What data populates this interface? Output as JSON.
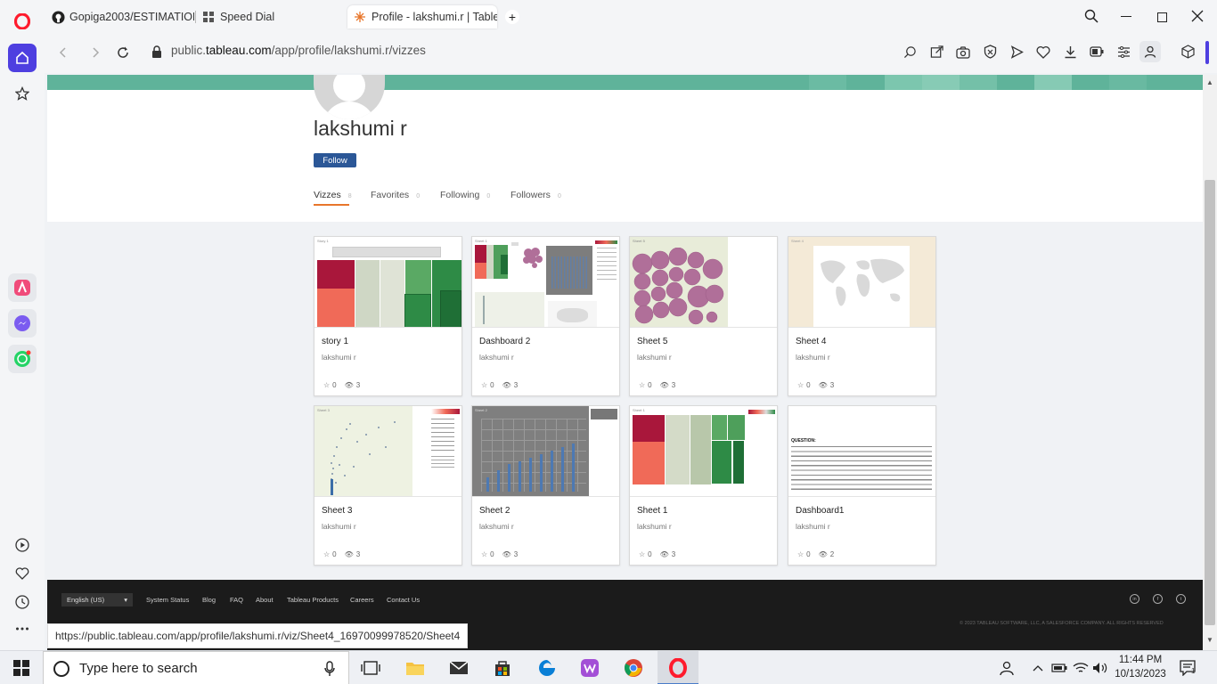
{
  "browser": {
    "tabs": [
      {
        "title": "Gopiga2003/ESTIMATION",
        "icon": "github-icon"
      },
      {
        "title": "Speed Dial",
        "icon": "speed-dial-icon"
      },
      {
        "title": "Profile - lakshumi.r | Table",
        "icon": "tableau-icon",
        "active": true
      }
    ],
    "url_prefix": "public.",
    "url_host": "tableau.com",
    "url_path": "/app/profile/lakshumi.r/vizzes",
    "status_url": "https://public.tableau.com/app/profile/lakshumi.r/viz/Sheet4_16970099978520/Sheet4"
  },
  "profile": {
    "name": "lakshumi r",
    "follow_label": "Follow",
    "tabs": [
      {
        "label": "Vizzes",
        "count": "8"
      },
      {
        "label": "Favorites",
        "count": "0"
      },
      {
        "label": "Following",
        "count": "0"
      },
      {
        "label": "Followers",
        "count": "0"
      }
    ]
  },
  "vizzes": [
    {
      "title": "story 1",
      "author": "lakshumi r",
      "favorites": "0",
      "views": "3",
      "thumb": "story",
      "thumb_label": "Story 1"
    },
    {
      "title": "Dashboard 2",
      "author": "lakshumi r",
      "favorites": "0",
      "views": "3",
      "thumb": "dashboard",
      "thumb_label": "Sheet 1"
    },
    {
      "title": "Sheet 5",
      "author": "lakshumi r",
      "favorites": "0",
      "views": "3",
      "thumb": "bubbles",
      "thumb_label": "Sheet 5"
    },
    {
      "title": "Sheet 4",
      "author": "lakshumi r",
      "favorites": "0",
      "views": "3",
      "thumb": "map",
      "thumb_label": "Sheet 4"
    },
    {
      "title": "Sheet 3",
      "author": "lakshumi r",
      "favorites": "0",
      "views": "3",
      "thumb": "scatter",
      "thumb_label": "Sheet 3"
    },
    {
      "title": "Sheet 2",
      "author": "lakshumi r",
      "favorites": "0",
      "views": "3",
      "thumb": "bars",
      "thumb_label": "Sheet 2"
    },
    {
      "title": "Sheet 1",
      "author": "lakshumi r",
      "favorites": "0",
      "views": "3",
      "thumb": "treemap",
      "thumb_label": "Sheet 1"
    },
    {
      "title": "Dashboard1",
      "author": "lakshumi r",
      "favorites": "0",
      "views": "2",
      "thumb": "text",
      "thumb_label": "QUESTION:"
    }
  ],
  "footer": {
    "language": "English (US)",
    "links": [
      "System Status",
      "Blog",
      "FAQ",
      "About",
      "Tableau Products",
      "Careers",
      "Contact Us"
    ],
    "copyright": "© 2023 TABLEAU SOFTWARE, LLC, A SALESFORCE COMPANY. ALL RIGHTS RESERVED",
    "social": [
      "in",
      "f",
      "t"
    ]
  },
  "taskbar": {
    "search_placeholder": "Type here to search",
    "time": "11:44 PM",
    "date": "10/13/2023",
    "notification_count": "1"
  },
  "colors": {
    "accent_green": "#5fb39a",
    "follow_blue": "#2b5797",
    "tab_underline": "#e8762b",
    "bubble": "#b06f99",
    "treemap_red": "#a9173b",
    "treemap_salmon": "#f06a58",
    "treemap_green": "#2e8b46"
  }
}
